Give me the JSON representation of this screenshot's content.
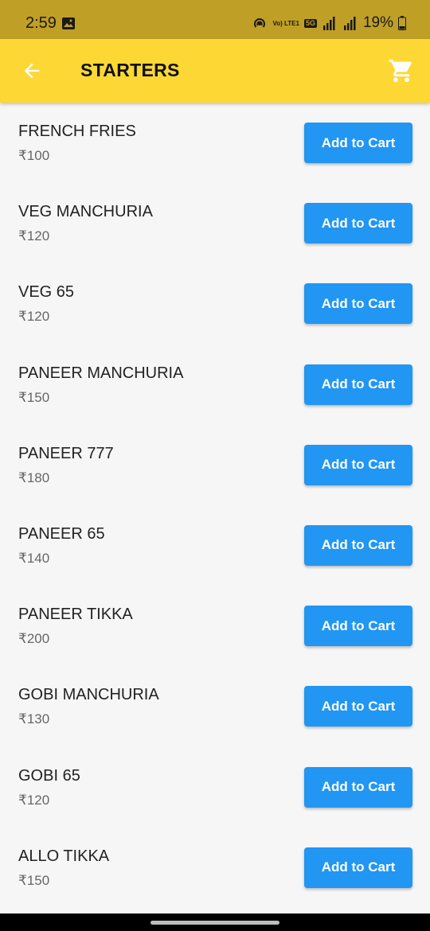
{
  "status_bar": {
    "time": "2:59",
    "volte_label": "Vo) LTE1",
    "network_label": "5G",
    "battery_percent": "19%"
  },
  "app_bar": {
    "title": "STARTERS",
    "back_icon": "arrow-back-icon",
    "cart_icon": "shopping-cart-icon"
  },
  "items": [
    {
      "name": "FRENCH FRIES",
      "price": "₹100",
      "button": "Add to Cart"
    },
    {
      "name": "VEG MANCHURIA",
      "price": "₹120",
      "button": "Add to Cart"
    },
    {
      "name": "VEG 65",
      "price": "₹120",
      "button": "Add to Cart"
    },
    {
      "name": "PANEER MANCHURIA",
      "price": "₹150",
      "button": "Add to Cart"
    },
    {
      "name": "PANEER 777",
      "price": "₹180",
      "button": "Add to Cart"
    },
    {
      "name": "PANEER 65",
      "price": "₹140",
      "button": "Add to Cart"
    },
    {
      "name": "PANEER TIKKA",
      "price": "₹200",
      "button": "Add to Cart"
    },
    {
      "name": "GOBI MANCHURIA",
      "price": "₹130",
      "button": "Add to Cart"
    },
    {
      "name": "GOBI 65",
      "price": "₹120",
      "button": "Add to Cart"
    },
    {
      "name": "ALLO TIKKA",
      "price": "₹150",
      "button": "Add to Cart"
    }
  ],
  "colors": {
    "status_bar": "#bf9f26",
    "app_bar": "#fdd835",
    "button": "#2196f3",
    "background": "#f6f6f6"
  }
}
